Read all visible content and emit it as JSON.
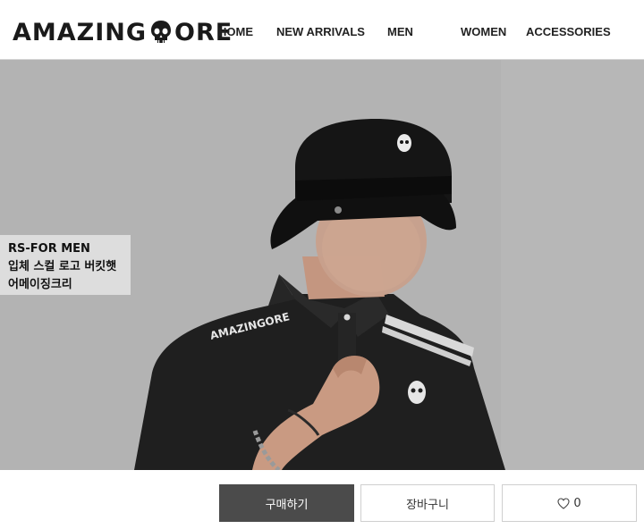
{
  "brand": {
    "name_part1": "AMAZING",
    "name_part2": "ORE",
    "logo_icon": "skull-icon"
  },
  "nav": {
    "items": [
      {
        "label": "HOME"
      },
      {
        "label": "NEW ARRIVALS"
      },
      {
        "label": "MEN"
      },
      {
        "label": "WOMEN"
      },
      {
        "label": "ACCESSORIES"
      }
    ]
  },
  "hero": {
    "caption": {
      "line1": "RS-FOR MEN",
      "line2": "입체 스컬 로고 버킷햇",
      "line3": "어메이징크리"
    },
    "shirt_print": "AMAZINGORE"
  },
  "actions": {
    "buy_label": "구매하기",
    "cart_label": "장바구니",
    "like_count": "0",
    "like_icon": "heart-icon"
  },
  "colors": {
    "buy_button_bg": "#4b4b4b",
    "background": "#ffffff"
  }
}
